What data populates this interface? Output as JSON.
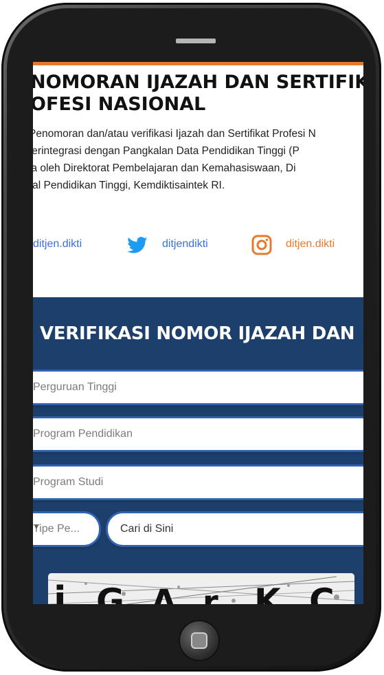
{
  "header": {
    "title_line1": "NOMORAN IJAZAH DAN SERTIFIK",
    "title_line2": "OFESI NASIONAL"
  },
  "description": {
    "line1": "Penomoran dan/atau verifikasi Ijazah dan Sertifikat Profesi N",
    "line2": "terintegrasi dengan Pangkalan Data Pendidikan Tinggi (P",
    "line3": "la oleh Direktorat Pembelajaran dan Kemahasiswaan, Di",
    "line4": "ral Pendidikan Tinggi, Kemdiktisaintek RI."
  },
  "social": {
    "facebook_label": "ditjen.dikti",
    "twitter_label": "ditjendikti",
    "instagram_label": "ditjen.dikti",
    "facebook_color": "#3b6fd8",
    "twitter_color": "#1d9bf0",
    "instagram_color": "#e8792a"
  },
  "verification": {
    "title": "VERIFIKASI NOMOR IJAZAH DAN",
    "perguruan_tinggi_placeholder": "Perguruan Tinggi",
    "program_pendidikan_placeholder": "Program Pendidikan",
    "program_studi_placeholder": "Program Studi",
    "tipe_placeholder": "Tipe Pe...",
    "search_placeholder": "Cari di Sini"
  },
  "colors": {
    "section_background": "#1d3f6b",
    "field_border": "#2f63b0",
    "accent_line": "#e8792a"
  },
  "icons": [
    "twitter-icon",
    "instagram-icon",
    "chevron-down-icon",
    "home-button-icon"
  ]
}
